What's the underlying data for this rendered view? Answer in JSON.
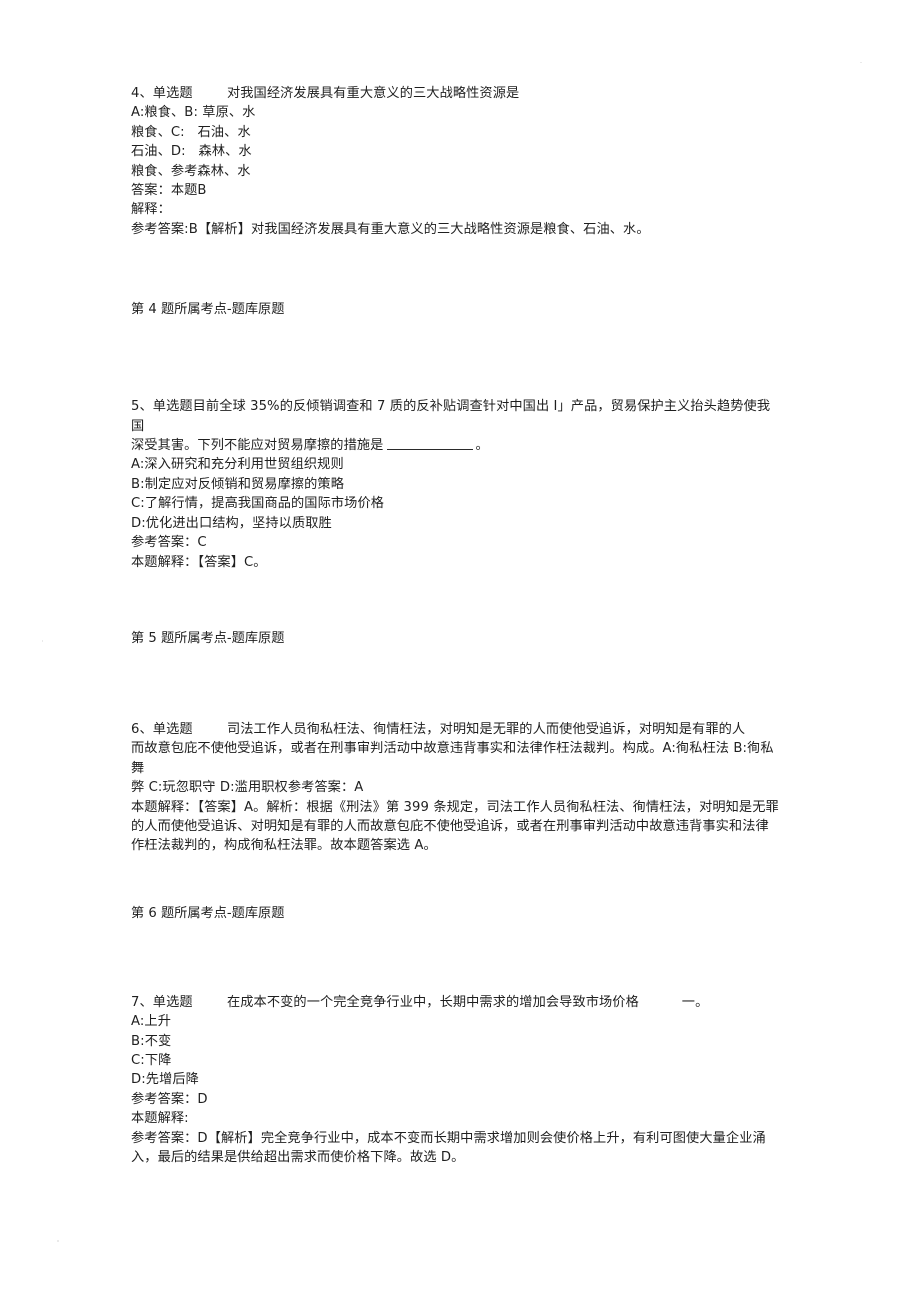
{
  "document": {
    "type": "exam-practice-sheet",
    "language": "zh-CN"
  },
  "questions": [
    {
      "id": "q4",
      "header": "4、单选题        对我国经济发展具有重大意义的三大战略性资源是",
      "lines": [
        "A:粮食、B: 草原、水",
        "粮食、C:   石油、水",
        "石油、D:   森林、水",
        "粮食、参考森林、水",
        "答案：本题B",
        "解释：",
        "参考答案:B【解析】对我国经济发展具有重大意义的三大战略性资源是粮食、石油、水。"
      ],
      "kaodian": "第 4 题所属考点-题库原题"
    },
    {
      "id": "q5",
      "header": "5、单选题目前全球 35%的反倾销调查和 7 质的反补贴调查针对中国出 I」产品，贸易保护主义抬头趋势使我国",
      "stem_part2_before_blank": "深受其害。下列不能应对贸易摩擦的措施是",
      "stem_part2_after_blank": "。",
      "lines": [
        "A:深入研究和充分利用世贸组织规则",
        "B:制定应对反倾销和贸易摩擦的策略",
        "C:了解行情，提高我国商品的国际市场价格",
        "D:优化进出口结构，坚持以质取胜",
        "参考答案：C",
        "本题解释：【答案】C。"
      ],
      "kaodian": "第 5 题所属考点-题库原题"
    },
    {
      "id": "q6",
      "header": "6、单选题        司法工作人员徇私枉法、徇情枉法，对明知是无罪的人而使他受追诉，对明知是有罪的人",
      "lines": [
        "而故意包庇不使他受追诉，或者在刑事审判活动中故意违背事实和法律作枉法裁判。构成。A:徇私枉法 B:徇私舞",
        "弊 C:玩忽职守 D:滥用职权参考答案：A",
        "本题解释：【答案】A。解析：根据《刑法》第 399 条规定，司法工作人员徇私枉法、徇情枉法，对明知是无罪",
        "的人而使他受追诉、对明知是有罪的人而故意包庇不使他受追诉，或者在刑事审判活动中故意违背事实和法律",
        "作枉法裁判的，构成徇私枉法罪。故本题答案选 A。"
      ],
      "kaodian": "第 6 题所属考点-题库原题"
    },
    {
      "id": "q7",
      "header": "7、单选题        在成本不变的一个完全竞争行业中，长期中需求的增加会导致市场价格          一。",
      "lines": [
        "A:上升",
        "B:不变",
        "C:下降",
        "D:先增后降",
        "参考答案：D",
        "本题解释:",
        "参考答案：D【解析】完全竞争行业中，成本不变而长期中需求增加则会使价格上升，有利可图使大量企业涌",
        "入，最后的结果是供给超出需求而使价格下降。故选 D。"
      ],
      "kaodian": ""
    }
  ]
}
